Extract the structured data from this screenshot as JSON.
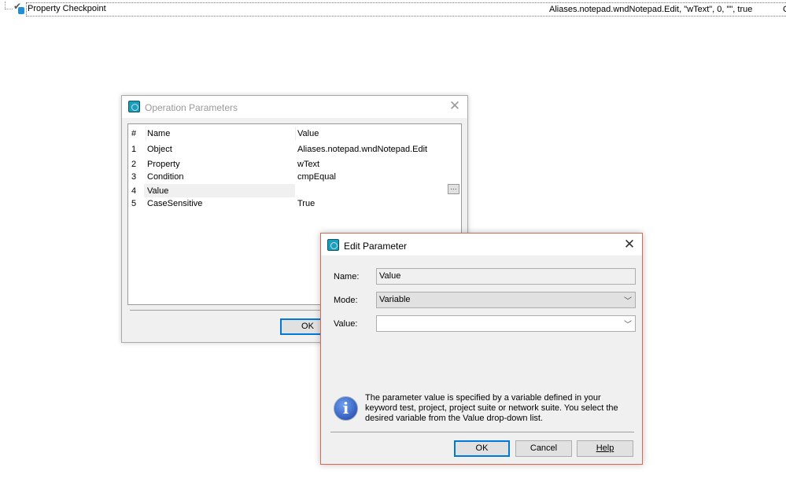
{
  "top_row": {
    "label": "Property Checkpoint",
    "value": "Aliases.notepad.wndNotepad.Edit, \"wText\", 0, \"\", true",
    "trailing": "C"
  },
  "op_dialog": {
    "title": "Operation Parameters",
    "columns": [
      "#",
      "Name",
      "Value"
    ],
    "rows": [
      {
        "n": "1",
        "name": "Object",
        "value": "Aliases.notepad.wndNotepad.Edit"
      },
      {
        "n": "2",
        "name": "Property",
        "value": "wText"
      },
      {
        "n": "3",
        "name": "Condition",
        "value": "cmpEqual"
      },
      {
        "n": "4",
        "name": "Value",
        "value": ""
      },
      {
        "n": "5",
        "name": "CaseSensitive",
        "value": "True"
      }
    ],
    "ellipsis": "···",
    "ok": "OK"
  },
  "edit_dialog": {
    "title": "Edit Parameter",
    "name_label": "Name:",
    "name_value": "Value",
    "mode_label": "Mode:",
    "mode_value": "Variable",
    "value_label": "Value:",
    "value_value": "",
    "info": "The parameter value is specified by a variable defined in your keyword test, project, project suite or network suite. You select the desired variable from the Value drop-down list.",
    "ok": "OK",
    "cancel": "Cancel",
    "help": "Help"
  },
  "colors": {
    "accent": "#0078d7",
    "edit_border": "#d46a52"
  }
}
